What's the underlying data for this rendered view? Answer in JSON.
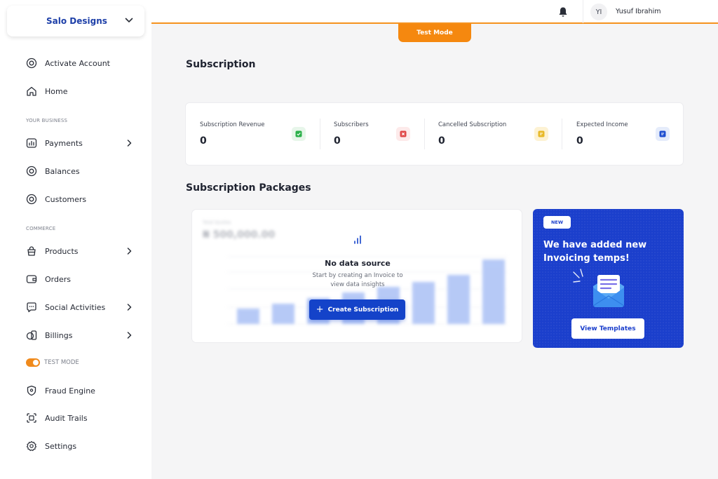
{
  "sidebar": {
    "org_name": "Salo Designs",
    "items": [
      {
        "label": "Activate Account",
        "icon": "activate-icon"
      },
      {
        "label": "Home",
        "icon": "home-icon"
      },
      {
        "label": "Payments",
        "icon": "payments-icon",
        "has_submenu": true
      },
      {
        "label": "Balances",
        "icon": "balances-icon"
      },
      {
        "label": "Customers",
        "icon": "customers-icon"
      },
      {
        "label": "Products",
        "icon": "products-icon",
        "has_submenu": true
      },
      {
        "label": "Orders",
        "icon": "orders-icon"
      },
      {
        "label": "Social Activities",
        "icon": "social-icon",
        "has_submenu": true
      },
      {
        "label": "Billings",
        "icon": "billings-icon",
        "has_submenu": true
      },
      {
        "label": "Fraud Engine",
        "icon": "fraud-icon"
      },
      {
        "label": "Audit Trails",
        "icon": "audit-icon"
      },
      {
        "label": "Settings",
        "icon": "settings-icon"
      }
    ],
    "sections": {
      "business": "YOUR BUSINESS",
      "commerce": "COMMERCE"
    },
    "test_mode_label": "TEST MODE",
    "test_mode_on": true
  },
  "topbar": {
    "avatar_initials": "YI",
    "username": "Yusuf Ibrahim",
    "test_mode_tab": "Test Mode"
  },
  "page": {
    "title": "Subscription",
    "stats": [
      {
        "label": "Subscription Revenue",
        "value": "0",
        "badge_color": "#e7f6ea",
        "icon_color": "#2bb04a"
      },
      {
        "label": "Subscribers",
        "value": "0",
        "badge_color": "#fdeaea",
        "icon_color": "#e04848"
      },
      {
        "label": "Cancelled Subscription",
        "value": "0",
        "badge_color": "#fdf2d3",
        "icon_color": "#e8b928"
      },
      {
        "label": "Expected Income",
        "value": "0",
        "badge_color": "#e5ecfb",
        "icon_color": "#1f4fd0"
      }
    ],
    "packages_title": "Subscription Packages",
    "empty_state": {
      "blurred_label": "Total Quotes",
      "blurred_amount": "₦ 500,000.00",
      "title": "No data source",
      "subtitle": "Start by creating an Invoice to view data insights",
      "button_label": "Create Subscription"
    },
    "promo": {
      "badge": "NEW",
      "text": "We have added new Invoicing temps!",
      "button_label": "View Templates"
    }
  },
  "colors": {
    "accent": "#f5880f",
    "brand_blue": "#1443c9"
  }
}
